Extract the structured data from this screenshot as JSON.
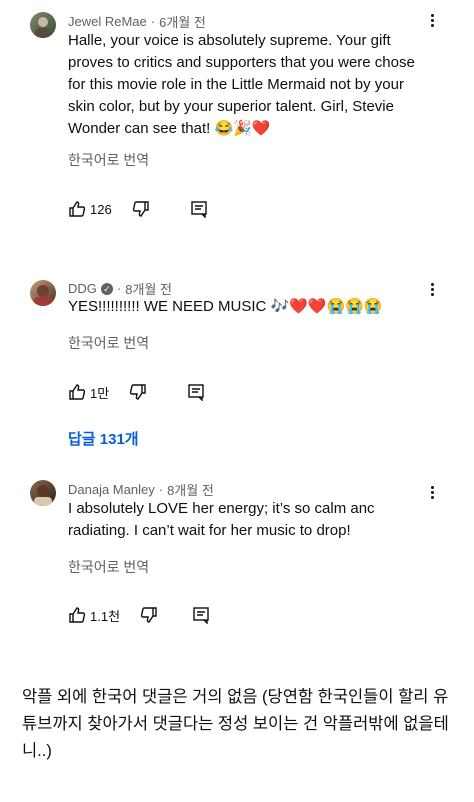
{
  "comments": [
    {
      "author": "Jewel ReMae",
      "time": "6개월 전",
      "verified": false,
      "text": "Halle, your voice is absolutely supreme. Your gift proves to critics and supporters that you were chose for this movie role in the Little Mermaid not by your skin color, but by your superior talent. Girl, Stevie Wonder can see that! 😂🎉❤️",
      "translate": "한국어로 번역",
      "likes": "126"
    },
    {
      "author": "DDG",
      "time": "8개월 전",
      "verified": true,
      "text": "YES!!!!!!!!!! WE NEED MUSIC 🎶❤️❤️😭😭😭",
      "translate": "한국어로 번역",
      "likes": "1만"
    },
    {
      "author": "Danaja Manley",
      "time": "8개월 전",
      "verified": false,
      "text": "I absolutely LOVE her energy; it’s so calm anc radiating. I can’t wait for her music to drop!",
      "translate": "한국어로 번역",
      "likes": "1.1천"
    }
  ],
  "replies_label": "답글 131개",
  "caption": "악플 외에 한국어 댓글은 거의 없음 (당연함 한국인들이 할리 유튜브까지 찾아가서 댓글다는 정성 보이는 건 악플러밖에 없을테니..)",
  "icons": [
    "thumbs-up-icon",
    "thumbs-down-icon",
    "reply-icon",
    "more-vert-icon",
    "verified-check-icon"
  ]
}
